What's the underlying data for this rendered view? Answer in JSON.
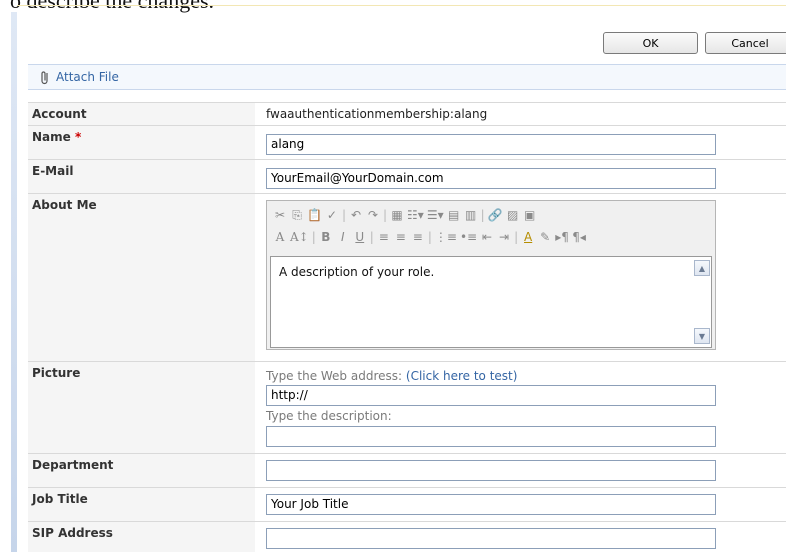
{
  "top_cut_text": "o describe the changes.",
  "buttons": {
    "ok": "OK",
    "cancel": "Cancel"
  },
  "toolbar": {
    "attach_file": "Attach File"
  },
  "fields": {
    "account": {
      "label": "Account",
      "value": "fwaauthenticationmembership:alang"
    },
    "name": {
      "label": "Name",
      "required_mark": "*",
      "value": "alang"
    },
    "email": {
      "label": "E-Mail",
      "value": "YourEmail@YourDomain.com"
    },
    "about_me": {
      "label": "About Me",
      "value": "A description of your role."
    },
    "picture": {
      "label": "Picture",
      "url_hint": "Type the Web address:",
      "test_link_open": "(",
      "test_link": "Click here to test",
      "test_link_close": ")",
      "url_value": "http://",
      "description_hint": "Type the description:",
      "description_value": ""
    },
    "department": {
      "label": "Department",
      "value": ""
    },
    "job_title": {
      "label": "Job Title",
      "value": "Your Job Title"
    },
    "sip_address": {
      "label": "SIP Address",
      "value": ""
    }
  },
  "rte_toolbar": {
    "row1": [
      "cut-icon",
      "copy-icon",
      "paste-icon",
      "spellcheck-icon",
      "undo-icon",
      "redo-icon",
      "insert-table-icon",
      "table-menu-icon",
      "insert-menu-icon",
      "table-props-icon",
      "layout-icon",
      "hyperlink-icon",
      "image-icon",
      "symbol-icon"
    ],
    "row2": [
      "font-color-icon",
      "font-size-icon",
      "bold-icon",
      "italic-icon",
      "underline-icon",
      "align-left-icon",
      "align-center-icon",
      "align-right-icon",
      "numbered-list-icon",
      "bullet-list-icon",
      "outdent-icon",
      "indent-icon",
      "text-color-icon",
      "highlight-icon",
      "ltr-icon",
      "rtl-icon"
    ]
  },
  "colors": {
    "link": "#3465a4",
    "required": "#cc0000",
    "label_bg": "#f5f5f5",
    "toolbar_bg": "#f4f8fd"
  }
}
